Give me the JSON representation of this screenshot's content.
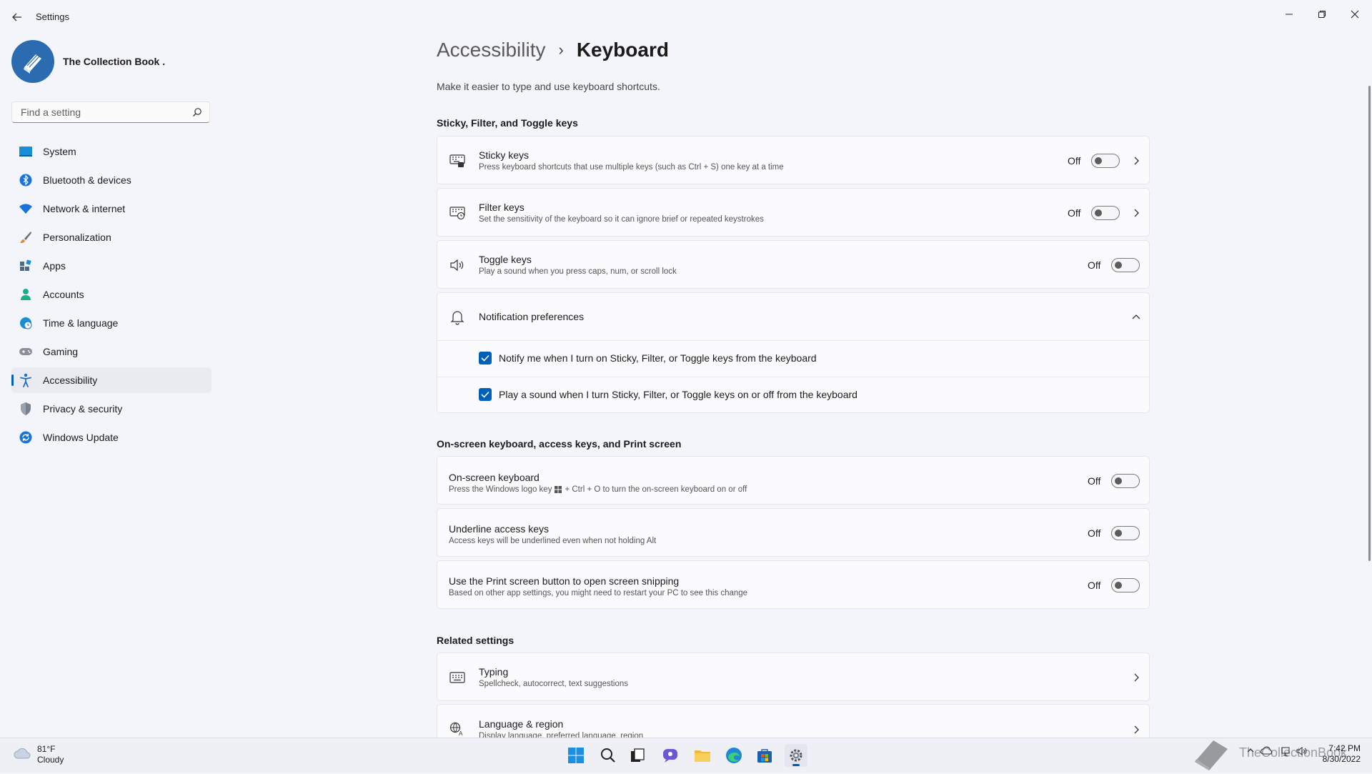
{
  "window": {
    "title": "Settings",
    "controls": [
      "minimize",
      "maximize",
      "close"
    ]
  },
  "profile": {
    "name": "The Collection Book ."
  },
  "search": {
    "placeholder": "Find a setting"
  },
  "sidebar": {
    "items": [
      {
        "label": "System",
        "icon": "system-icon"
      },
      {
        "label": "Bluetooth & devices",
        "icon": "bluetooth-icon"
      },
      {
        "label": "Network & internet",
        "icon": "wifi-icon"
      },
      {
        "label": "Personalization",
        "icon": "brush-icon"
      },
      {
        "label": "Apps",
        "icon": "apps-icon"
      },
      {
        "label": "Accounts",
        "icon": "person-icon"
      },
      {
        "label": "Time & language",
        "icon": "globe-clock-icon"
      },
      {
        "label": "Gaming",
        "icon": "gamepad-icon"
      },
      {
        "label": "Accessibility",
        "icon": "accessibility-icon",
        "active": true
      },
      {
        "label": "Privacy & security",
        "icon": "shield-icon"
      },
      {
        "label": "Windows Update",
        "icon": "update-icon"
      }
    ]
  },
  "header": {
    "parent": "Accessibility",
    "separator": "›",
    "current": "Keyboard",
    "description": "Make it easier to type and use keyboard shortcuts."
  },
  "sections": {
    "sticky_filter_toggle": "Sticky, Filter, and Toggle keys",
    "onscreen": "On-screen keyboard, access keys, and Print screen",
    "related": "Related settings"
  },
  "settings": {
    "sticky": {
      "title": "Sticky keys",
      "sub": "Press keyboard shortcuts that use multiple keys (such as Ctrl + S) one key at a time",
      "state": "Off"
    },
    "filter": {
      "title": "Filter keys",
      "sub": "Set the sensitivity of the keyboard so it can ignore brief or repeated keystrokes",
      "state": "Off"
    },
    "toggle": {
      "title": "Toggle keys",
      "sub": "Play a sound when you press caps, num, or scroll lock",
      "state": "Off"
    },
    "notification": {
      "title": "Notification preferences",
      "option1": "Notify me when I turn on Sticky, Filter, or Toggle keys from the keyboard",
      "option2": "Play a sound when I turn Sticky, Filter, or Toggle keys on or off from the keyboard",
      "option1_checked": true,
      "option2_checked": true
    },
    "onscreen_keyboard": {
      "title": "On-screen keyboard",
      "sub_before": "Press the Windows logo key",
      "sub_after": "+ Ctrl + O to turn the on-screen keyboard on or off",
      "state": "Off"
    },
    "underline": {
      "title": "Underline access keys",
      "sub": "Access keys will be underlined even when not holding Alt",
      "state": "Off"
    },
    "printscreen": {
      "title": "Use the Print screen button to open screen snipping",
      "sub": "Based on other app settings, you might need to restart your PC to see this change",
      "state": "Off"
    }
  },
  "related": {
    "typing": {
      "title": "Typing",
      "sub": "Spellcheck, autocorrect, text suggestions"
    },
    "language": {
      "title": "Language & region",
      "sub": "Display language, preferred language, region"
    }
  },
  "taskbar": {
    "weather_temp": "81°F",
    "weather_cond": "Cloudy",
    "time": "7:42 PM",
    "date": "8/30/2022",
    "watermark": "TheCollectionBook"
  },
  "colors": {
    "accent": "#005fb8",
    "background": "#f3f5fb"
  }
}
